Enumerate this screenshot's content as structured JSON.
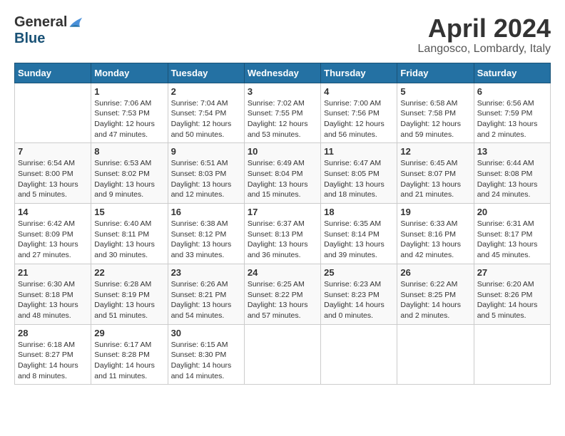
{
  "logo": {
    "general": "General",
    "blue": "Blue"
  },
  "title": "April 2024",
  "location": "Langosco, Lombardy, Italy",
  "weekdays": [
    "Sunday",
    "Monday",
    "Tuesday",
    "Wednesday",
    "Thursday",
    "Friday",
    "Saturday"
  ],
  "weeks": [
    [
      {
        "day": "",
        "info": ""
      },
      {
        "day": "1",
        "info": "Sunrise: 7:06 AM\nSunset: 7:53 PM\nDaylight: 12 hours\nand 47 minutes."
      },
      {
        "day": "2",
        "info": "Sunrise: 7:04 AM\nSunset: 7:54 PM\nDaylight: 12 hours\nand 50 minutes."
      },
      {
        "day": "3",
        "info": "Sunrise: 7:02 AM\nSunset: 7:55 PM\nDaylight: 12 hours\nand 53 minutes."
      },
      {
        "day": "4",
        "info": "Sunrise: 7:00 AM\nSunset: 7:56 PM\nDaylight: 12 hours\nand 56 minutes."
      },
      {
        "day": "5",
        "info": "Sunrise: 6:58 AM\nSunset: 7:58 PM\nDaylight: 12 hours\nand 59 minutes."
      },
      {
        "day": "6",
        "info": "Sunrise: 6:56 AM\nSunset: 7:59 PM\nDaylight: 13 hours\nand 2 minutes."
      }
    ],
    [
      {
        "day": "7",
        "info": "Sunrise: 6:54 AM\nSunset: 8:00 PM\nDaylight: 13 hours\nand 5 minutes."
      },
      {
        "day": "8",
        "info": "Sunrise: 6:53 AM\nSunset: 8:02 PM\nDaylight: 13 hours\nand 9 minutes."
      },
      {
        "day": "9",
        "info": "Sunrise: 6:51 AM\nSunset: 8:03 PM\nDaylight: 13 hours\nand 12 minutes."
      },
      {
        "day": "10",
        "info": "Sunrise: 6:49 AM\nSunset: 8:04 PM\nDaylight: 13 hours\nand 15 minutes."
      },
      {
        "day": "11",
        "info": "Sunrise: 6:47 AM\nSunset: 8:05 PM\nDaylight: 13 hours\nand 18 minutes."
      },
      {
        "day": "12",
        "info": "Sunrise: 6:45 AM\nSunset: 8:07 PM\nDaylight: 13 hours\nand 21 minutes."
      },
      {
        "day": "13",
        "info": "Sunrise: 6:44 AM\nSunset: 8:08 PM\nDaylight: 13 hours\nand 24 minutes."
      }
    ],
    [
      {
        "day": "14",
        "info": "Sunrise: 6:42 AM\nSunset: 8:09 PM\nDaylight: 13 hours\nand 27 minutes."
      },
      {
        "day": "15",
        "info": "Sunrise: 6:40 AM\nSunset: 8:11 PM\nDaylight: 13 hours\nand 30 minutes."
      },
      {
        "day": "16",
        "info": "Sunrise: 6:38 AM\nSunset: 8:12 PM\nDaylight: 13 hours\nand 33 minutes."
      },
      {
        "day": "17",
        "info": "Sunrise: 6:37 AM\nSunset: 8:13 PM\nDaylight: 13 hours\nand 36 minutes."
      },
      {
        "day": "18",
        "info": "Sunrise: 6:35 AM\nSunset: 8:14 PM\nDaylight: 13 hours\nand 39 minutes."
      },
      {
        "day": "19",
        "info": "Sunrise: 6:33 AM\nSunset: 8:16 PM\nDaylight: 13 hours\nand 42 minutes."
      },
      {
        "day": "20",
        "info": "Sunrise: 6:31 AM\nSunset: 8:17 PM\nDaylight: 13 hours\nand 45 minutes."
      }
    ],
    [
      {
        "day": "21",
        "info": "Sunrise: 6:30 AM\nSunset: 8:18 PM\nDaylight: 13 hours\nand 48 minutes."
      },
      {
        "day": "22",
        "info": "Sunrise: 6:28 AM\nSunset: 8:19 PM\nDaylight: 13 hours\nand 51 minutes."
      },
      {
        "day": "23",
        "info": "Sunrise: 6:26 AM\nSunset: 8:21 PM\nDaylight: 13 hours\nand 54 minutes."
      },
      {
        "day": "24",
        "info": "Sunrise: 6:25 AM\nSunset: 8:22 PM\nDaylight: 13 hours\nand 57 minutes."
      },
      {
        "day": "25",
        "info": "Sunrise: 6:23 AM\nSunset: 8:23 PM\nDaylight: 14 hours\nand 0 minutes."
      },
      {
        "day": "26",
        "info": "Sunrise: 6:22 AM\nSunset: 8:25 PM\nDaylight: 14 hours\nand 2 minutes."
      },
      {
        "day": "27",
        "info": "Sunrise: 6:20 AM\nSunset: 8:26 PM\nDaylight: 14 hours\nand 5 minutes."
      }
    ],
    [
      {
        "day": "28",
        "info": "Sunrise: 6:18 AM\nSunset: 8:27 PM\nDaylight: 14 hours\nand 8 minutes."
      },
      {
        "day": "29",
        "info": "Sunrise: 6:17 AM\nSunset: 8:28 PM\nDaylight: 14 hours\nand 11 minutes."
      },
      {
        "day": "30",
        "info": "Sunrise: 6:15 AM\nSunset: 8:30 PM\nDaylight: 14 hours\nand 14 minutes."
      },
      {
        "day": "",
        "info": ""
      },
      {
        "day": "",
        "info": ""
      },
      {
        "day": "",
        "info": ""
      },
      {
        "day": "",
        "info": ""
      }
    ]
  ]
}
